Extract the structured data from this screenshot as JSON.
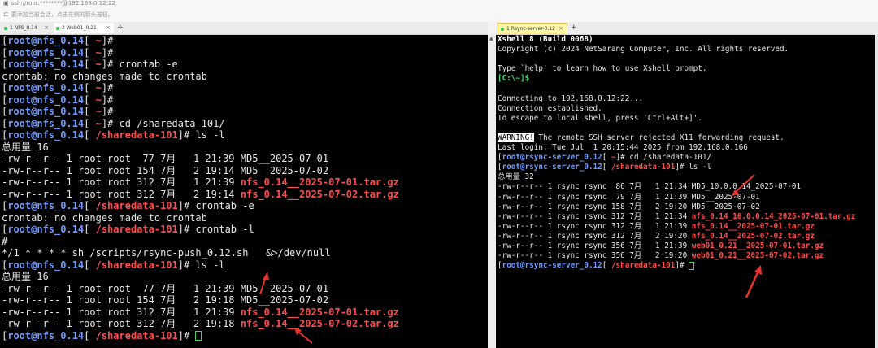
{
  "window": {
    "title": "ssh://root:********@192.168.0.12:22",
    "hint": "要添加当前会话，点击左侧的箭头按钮。"
  },
  "left_tabs": [
    {
      "label": "1 NFS_0.14",
      "close": "×"
    },
    {
      "label": "2 Web01_0.21",
      "close": "×"
    }
  ],
  "right_tabs": [
    {
      "label": "1 Rsync-server-0.12",
      "close": "×"
    }
  ],
  "add_tab": "+",
  "left_terminal": [
    [
      {
        "t": "[",
        "c": "white"
      },
      {
        "t": "root@nfs_0.14",
        "c": "blue"
      },
      {
        "t": "[ ",
        "c": "white"
      },
      {
        "t": "~",
        "c": "red"
      },
      {
        "t": "]#",
        "c": "white"
      }
    ],
    [
      {
        "t": "[",
        "c": "white"
      },
      {
        "t": "root@nfs_0.14",
        "c": "blue"
      },
      {
        "t": "[ ",
        "c": "white"
      },
      {
        "t": "~",
        "c": "red"
      },
      {
        "t": "]#",
        "c": "white"
      }
    ],
    [
      {
        "t": "[",
        "c": "white"
      },
      {
        "t": "root@nfs_0.14",
        "c": "blue"
      },
      {
        "t": "[ ",
        "c": "white"
      },
      {
        "t": "~",
        "c": "red"
      },
      {
        "t": "]# crontab -e",
        "c": "white"
      }
    ],
    [
      {
        "t": "crontab: no changes made to crontab",
        "c": "white"
      }
    ],
    [
      {
        "t": "[",
        "c": "white"
      },
      {
        "t": "root@nfs_0.14",
        "c": "blue"
      },
      {
        "t": "[ ",
        "c": "white"
      },
      {
        "t": "~",
        "c": "red"
      },
      {
        "t": "]#",
        "c": "white"
      }
    ],
    [
      {
        "t": "[",
        "c": "white"
      },
      {
        "t": "root@nfs_0.14",
        "c": "blue"
      },
      {
        "t": "[ ",
        "c": "white"
      },
      {
        "t": "~",
        "c": "red"
      },
      {
        "t": "]#",
        "c": "white"
      }
    ],
    [
      {
        "t": "[",
        "c": "white"
      },
      {
        "t": "root@nfs_0.14",
        "c": "blue"
      },
      {
        "t": "[ ",
        "c": "white"
      },
      {
        "t": "~",
        "c": "red"
      },
      {
        "t": "]#",
        "c": "white"
      }
    ],
    [
      {
        "t": "[",
        "c": "white"
      },
      {
        "t": "root@nfs_0.14",
        "c": "blue"
      },
      {
        "t": "[ ",
        "c": "white"
      },
      {
        "t": "~",
        "c": "red"
      },
      {
        "t": "]# cd /sharedata-101/",
        "c": "white"
      }
    ],
    [
      {
        "t": "[",
        "c": "white"
      },
      {
        "t": "root@nfs_0.14",
        "c": "blue"
      },
      {
        "t": "[ ",
        "c": "white"
      },
      {
        "t": "/sharedata-101",
        "c": "red"
      },
      {
        "t": "]# ls -l",
        "c": "white"
      }
    ],
    [
      {
        "t": "总用量 16",
        "c": "white"
      }
    ],
    [
      {
        "t": "-rw-r--r-- 1 root root  77 7月   1 21:39 MD5__2025-07-01",
        "c": "white"
      }
    ],
    [
      {
        "t": "-rw-r--r-- 1 root root 154 7月   2 19:14 MD5__2025-07-02",
        "c": "white"
      }
    ],
    [
      {
        "t": "-rw-r--r-- 1 root root 312 7月   1 21:39 ",
        "c": "white"
      },
      {
        "t": "nfs_0.14__2025-07-01.tar.gz",
        "c": "red"
      }
    ],
    [
      {
        "t": "-rw-r--r-- 1 root root 312 7月   2 19:14 ",
        "c": "white"
      },
      {
        "t": "nfs_0.14__2025-07-02.tar.gz",
        "c": "red"
      }
    ],
    [
      {
        "t": "[",
        "c": "white"
      },
      {
        "t": "root@nfs_0.14",
        "c": "blue"
      },
      {
        "t": "[ ",
        "c": "white"
      },
      {
        "t": "/sharedata-101",
        "c": "red"
      },
      {
        "t": "]# crontab -e",
        "c": "white"
      }
    ],
    [
      {
        "t": "crontab: no changes made to crontab",
        "c": "white"
      }
    ],
    [
      {
        "t": "[",
        "c": "white"
      },
      {
        "t": "root@nfs_0.14",
        "c": "blue"
      },
      {
        "t": "[ ",
        "c": "white"
      },
      {
        "t": "/sharedata-101",
        "c": "red"
      },
      {
        "t": "]# crontab -l",
        "c": "white"
      }
    ],
    [
      {
        "t": "#",
        "c": "white"
      }
    ],
    [
      {
        "t": "*/1 * * * * sh /scripts/rsync-push_0.12.sh   &>/dev/null",
        "c": "white"
      }
    ],
    [
      {
        "t": "[",
        "c": "white"
      },
      {
        "t": "root@nfs_0.14",
        "c": "blue"
      },
      {
        "t": "[ ",
        "c": "white"
      },
      {
        "t": "/sharedata-101",
        "c": "red"
      },
      {
        "t": "]# ls -l",
        "c": "white"
      }
    ],
    [
      {
        "t": "总用量 16",
        "c": "white"
      }
    ],
    [
      {
        "t": "-rw-r--r-- 1 root root  77 7月   1 21:39 MD5__2025-07-01",
        "c": "white"
      }
    ],
    [
      {
        "t": "-rw-r--r-- 1 root root 154 7月   2 19:18 MD5__2025-07-02",
        "c": "white"
      }
    ],
    [
      {
        "t": "-rw-r--r-- 1 root root 312 7月   1 21:39 ",
        "c": "white"
      },
      {
        "t": "nfs_0.14__2025-07-01.tar.gz",
        "c": "red"
      }
    ],
    [
      {
        "t": "-rw-r--r-- 1 root root 312 7月   2 19:18 ",
        "c": "white"
      },
      {
        "t": "nfs_0.14__2025-07-02.tar.gz",
        "c": "red"
      }
    ],
    [
      {
        "t": "[",
        "c": "white"
      },
      {
        "t": "root@nfs_0.14",
        "c": "blue"
      },
      {
        "t": "[ ",
        "c": "white"
      },
      {
        "t": "/sharedata-101",
        "c": "red"
      },
      {
        "t": "]# ",
        "c": "white"
      },
      {
        "t": "",
        "c": "cursor"
      }
    ]
  ],
  "right_terminal": [
    [
      {
        "t": "Xshell 8 (Build 0068)",
        "c": "bold"
      }
    ],
    [
      {
        "t": "Copyright (c) 2024 NetSarang Computer, Inc. All rights reserved.",
        "c": "white"
      }
    ],
    [
      {
        "t": "",
        "c": "white"
      }
    ],
    [
      {
        "t": "Type `help' to learn how to use Xshell prompt.",
        "c": "white"
      }
    ],
    [
      {
        "t": "[C:\\~]$",
        "c": "green"
      }
    ],
    [
      {
        "t": "",
        "c": "white"
      }
    ],
    [
      {
        "t": "Connecting to 192.168.0.12:22...",
        "c": "white"
      }
    ],
    [
      {
        "t": "Connection established.",
        "c": "white"
      }
    ],
    [
      {
        "t": "To escape to local shell, press 'Ctrl+Alt+]'.",
        "c": "white"
      }
    ],
    [
      {
        "t": "",
        "c": "white"
      }
    ],
    [
      {
        "t": "WARNING!",
        "c": "warn"
      },
      {
        "t": " The remote SSH server rejected X11 forwarding request.",
        "c": "white"
      }
    ],
    [
      {
        "t": "Last login: Tue Jul  1 20:15:44 2025 from 192.168.0.166",
        "c": "white"
      }
    ],
    [
      {
        "t": "[",
        "c": "white"
      },
      {
        "t": "root@rsync-server_0.12",
        "c": "blue"
      },
      {
        "t": "[ ",
        "c": "white"
      },
      {
        "t": "~",
        "c": "red"
      },
      {
        "t": "]# cd /sharedata-101/",
        "c": "white"
      }
    ],
    [
      {
        "t": "[",
        "c": "white"
      },
      {
        "t": "root@rsync-server_0.12",
        "c": "blue"
      },
      {
        "t": "[ ",
        "c": "white"
      },
      {
        "t": "/sharedata-101",
        "c": "red"
      },
      {
        "t": "]# ls -l",
        "c": "white"
      }
    ],
    [
      {
        "t": "总用量 32",
        "c": "white"
      }
    ],
    [
      {
        "t": "-rw-r--r-- 1 rsync rsync  86 7月   1 21:34 MD5_10.0.0.14_2025-07-01",
        "c": "white"
      }
    ],
    [
      {
        "t": "-rw-r--r-- 1 rsync rsync  79 7月   1 21:39 MD5__2025-07-01",
        "c": "white"
      }
    ],
    [
      {
        "t": "-rw-r--r-- 1 rsync rsync 158 7月   2 19:20 MD5__2025-07-02",
        "c": "white"
      }
    ],
    [
      {
        "t": "-rw-r--r-- 1 rsync rsync 312 7月   1 21:34 ",
        "c": "white"
      },
      {
        "t": "nfs_0.14_10.0.0.14_2025-07-01.tar.gz",
        "c": "red"
      }
    ],
    [
      {
        "t": "-rw-r--r-- 1 rsync rsync 312 7月   1 21:39 ",
        "c": "white"
      },
      {
        "t": "nfs_0.14__2025-07-01.tar.gz",
        "c": "red"
      }
    ],
    [
      {
        "t": "-rw-r--r-- 1 rsync rsync 312 7月   2 19:20 ",
        "c": "white"
      },
      {
        "t": "nfs_0.14__2025-07-02.tar.gz",
        "c": "red"
      }
    ],
    [
      {
        "t": "-rw-r--r-- 1 rsync rsync 356 7月   1 21:39 ",
        "c": "white"
      },
      {
        "t": "web01_0.21__2025-07-01.tar.gz",
        "c": "red"
      }
    ],
    [
      {
        "t": "-rw-r--r-- 1 rsync rsync 356 7月   2 19:20 ",
        "c": "white"
      },
      {
        "t": "web01_0.21__2025-07-02.tar.gz",
        "c": "red"
      }
    ],
    [
      {
        "t": "[",
        "c": "white"
      },
      {
        "t": "root@rsync-server_0.12",
        "c": "blue"
      },
      {
        "t": "[ ",
        "c": "white"
      },
      {
        "t": "/sharedata-101",
        "c": "red"
      },
      {
        "t": "]# ",
        "c": "white"
      },
      {
        "t": "",
        "c": "cursor"
      }
    ]
  ],
  "colors": {
    "prompt_user": "#6f9bff",
    "prompt_path": "#ff4d4d",
    "archive_file": "#ff4d4d",
    "local_prompt": "#47e067",
    "annotation_arrow": "#e8322a",
    "tab_active_dot": "#2ec24a"
  },
  "icons": [
    "terminal-icon",
    "add-session-icon",
    "tab-close-icon",
    "new-tab-icon",
    "annotation-arrow-icon"
  ]
}
